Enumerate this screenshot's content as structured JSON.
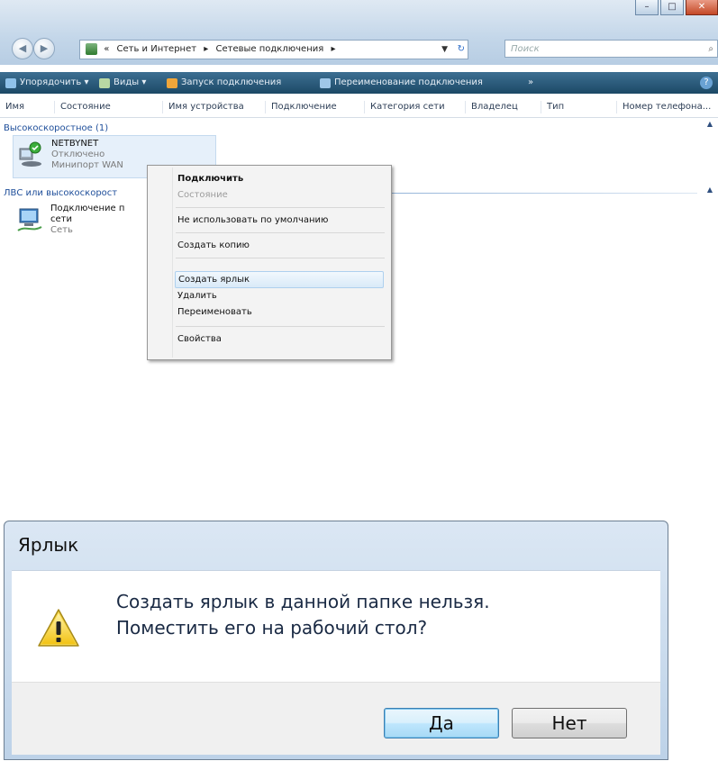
{
  "explorer": {
    "address": {
      "chevrons": "«",
      "crumbs": [
        "Сеть и Интернет",
        "Сетевые подключения"
      ],
      "separator": "▸"
    },
    "search_placeholder": "Поиск",
    "toolbar": {
      "organize": "Упорядочить ▾",
      "views": "Виды ▾",
      "start_connection": "Запуск подключения",
      "rename_connection": "Переименование подключения",
      "more": "»"
    },
    "columns": [
      "Имя",
      "Состояние",
      "Имя устройства",
      "Подключение",
      "Категория сети",
      "Владелец",
      "Тип",
      "Номер телефона..."
    ],
    "groups": [
      {
        "title": "Высокоскоростное (1)",
        "items": [
          {
            "name": "NETBYNET",
            "status": "Отключено",
            "device": "Минипорт WAN"
          }
        ]
      },
      {
        "title": "ЛВС или высокоскорост",
        "items": [
          {
            "name": "Подключение п",
            "line2": "сети",
            "line3": "Сеть"
          }
        ]
      }
    ]
  },
  "context_menu": {
    "items": [
      {
        "label": "Подключить",
        "style": "bold"
      },
      {
        "label": "Состояние",
        "style": "disabled"
      },
      {
        "label": "Не использовать по умолчанию"
      },
      {
        "label": "Создать копию"
      },
      {
        "label": "Создать ярлык",
        "style": "hover"
      },
      {
        "label": "Удалить"
      },
      {
        "label": "Переименовать"
      },
      {
        "label": "Свойства"
      }
    ]
  },
  "dialog": {
    "title": "Ярлык",
    "message_line1": "Создать ярлык в данной папке нельзя.",
    "message_line2": "Поместить его на рабочий стол?",
    "yes_label": "Да",
    "no_label": "Нет",
    "icon": "warning-icon"
  },
  "colors": {
    "toolbar": "#2a5a7c",
    "group_title": "#1e4e9a",
    "dialog_frame": "#bdd2e8",
    "menu_hover": "#d9eaf8"
  }
}
